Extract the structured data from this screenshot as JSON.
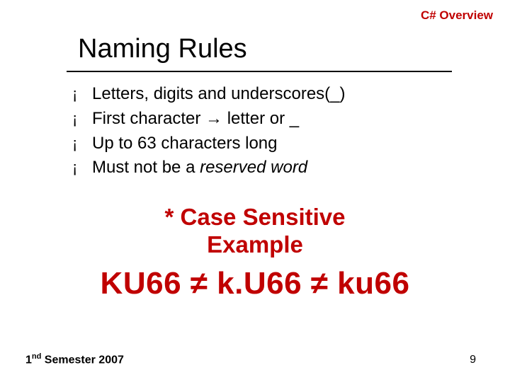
{
  "header": {
    "section_label": "C# Overview"
  },
  "title": "Naming Rules",
  "bullets": {
    "b1": "Letters, digits and underscores(_)",
    "b2_pre": "First character ",
    "b2_arrow": "→",
    "b2_post": " letter or _",
    "b3": "Up to 63 characters long",
    "b4_pre": "Must not be a ",
    "b4_em": "reserved word"
  },
  "case_sensitive": {
    "line1": "* Case Sensitive",
    "line2": "Example"
  },
  "example": "KU66 ≠ k.U66 ≠ ku66",
  "footer": {
    "left_pre": "1",
    "left_sup": "nd",
    "left_post": " Semester 2007",
    "page_number": "9"
  },
  "bullet_glyph": "¡"
}
